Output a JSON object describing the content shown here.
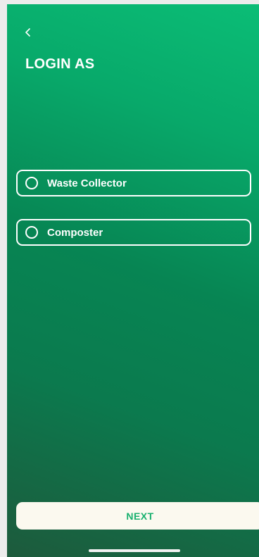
{
  "header": {
    "back_icon": "chevron-left-icon",
    "title": "LOGIN AS"
  },
  "options": [
    {
      "label": "Waste Collector",
      "selected": false
    },
    {
      "label": "Composter",
      "selected": false
    }
  ],
  "footer": {
    "next_label": "NEXT"
  },
  "colors": {
    "gradient_top": "#0bbd76",
    "gradient_bottom": "#1d5a3c",
    "button_bg": "#fbf9ef",
    "button_text": "#18b06e",
    "foreground": "#ffffff"
  }
}
